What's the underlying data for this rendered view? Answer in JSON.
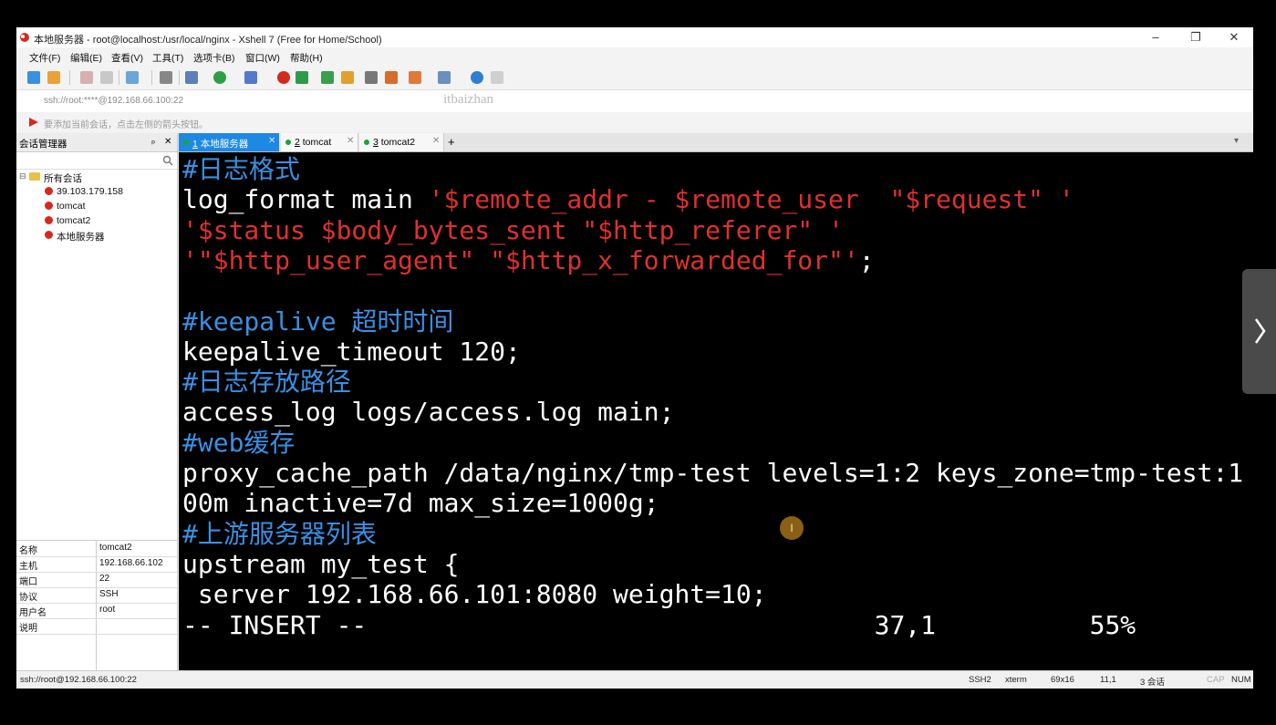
{
  "window": {
    "title": "本地服务器 - root@localhost:/usr/local/nginx - Xshell 7 (Free for Home/School)",
    "controls": {
      "minimize": "–",
      "maximize": "❐",
      "close": "✕"
    }
  },
  "menu": [
    "文件(F)",
    "编辑(E)",
    "查看(V)",
    "工具(T)",
    "选项卡(B)",
    "窗口(W)",
    "帮助(H)"
  ],
  "address": {
    "text": "ssh://root:****@192.168.66.100:22",
    "watermark": "itbaizhan"
  },
  "hint": "要添加当前会话，点击左侧的箭头按钮。",
  "session_manager": {
    "title": "会话管理器",
    "pin": "ₚ",
    "close": "✕",
    "root": "所有会话",
    "items": [
      "39.103.179.158",
      "tomcat",
      "tomcat2",
      "本地服务器"
    ]
  },
  "properties": [
    {
      "key": "名称",
      "value": "tomcat2"
    },
    {
      "key": "主机",
      "value": "192.168.66.102"
    },
    {
      "key": "端口",
      "value": "22"
    },
    {
      "key": "协议",
      "value": "SSH"
    },
    {
      "key": "用户名",
      "value": "root"
    },
    {
      "key": "说明",
      "value": ""
    }
  ],
  "tabs": [
    {
      "num": "1",
      "label": "本地服务器",
      "active": true
    },
    {
      "num": "2",
      "label": "tomcat",
      "active": false
    },
    {
      "num": "3",
      "label": "tomcat2",
      "active": false
    }
  ],
  "tab_add": "+",
  "terminal": {
    "lines": [
      [
        {
          "t": "#日志格式",
          "c": "blue"
        }
      ],
      [
        {
          "t": "log_format main ",
          "c": "white"
        },
        {
          "t": "'$remote_addr - $remote_user  \"$request\" '",
          "c": "red"
        }
      ],
      [
        {
          "t": "'$status $body_bytes_sent \"$http_referer\" '",
          "c": "red"
        }
      ],
      [
        {
          "t": "'\"$http_user_agent\" \"$http_x_forwarded_for\"'",
          "c": "red"
        },
        {
          "t": ";",
          "c": "white"
        }
      ],
      [
        {
          "t": "",
          "c": "white"
        }
      ],
      [
        {
          "t": "#keepalive 超时时间",
          "c": "blue"
        }
      ],
      [
        {
          "t": "keepalive_timeout 120;",
          "c": "white"
        }
      ],
      [
        {
          "t": "#日志存放路径",
          "c": "blue"
        }
      ],
      [
        {
          "t": "access_log logs/access.log main;",
          "c": "white"
        }
      ],
      [
        {
          "t": "#web缓存",
          "c": "blue"
        }
      ],
      [
        {
          "t": "p",
          "c": "cursor"
        },
        {
          "t": "roxy_cache_path /data/nginx/tmp-test levels=1:2 keys_zone=tmp-test:1",
          "c": "white"
        }
      ],
      [
        {
          "t": "00m inactive=7d max_size=1000g;",
          "c": "white"
        }
      ],
      [
        {
          "t": "#上游服务器列表",
          "c": "blue"
        }
      ],
      [
        {
          "t": "upstream my_test {",
          "c": "white"
        }
      ],
      [
        {
          "t": " server 192.168.66.101:8080 weight=10;",
          "c": "white"
        }
      ],
      [
        {
          "t": "-- INSERT --                                 37,1          55%",
          "c": "white"
        }
      ]
    ]
  },
  "status": {
    "left": "ssh://root@192.168.66.100:22",
    "protocol": "SSH2",
    "term": "xterm",
    "size": "69x16",
    "pos": "11,1",
    "sessions": "3 会话",
    "caps": "CAP",
    "num": "NUM"
  },
  "pointer_label": "I",
  "next_arrow": "›"
}
